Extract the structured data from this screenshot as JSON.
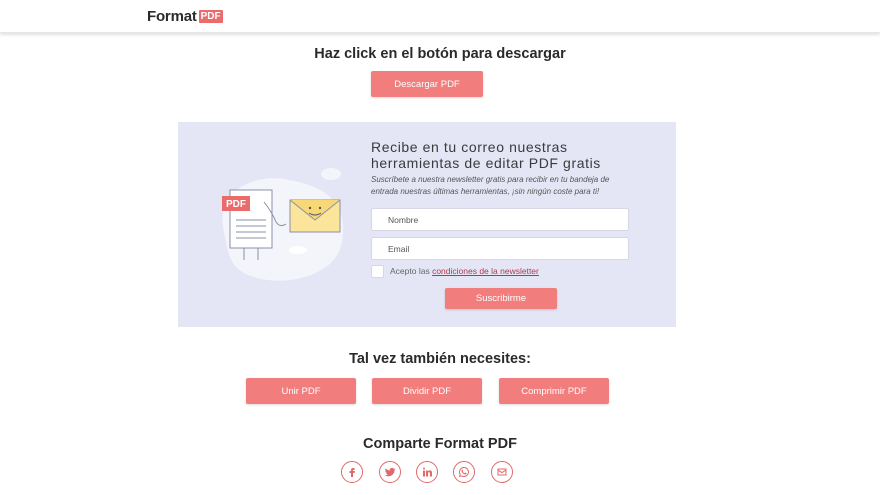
{
  "header": {
    "logo_text": "Format",
    "logo_badge": "PDF"
  },
  "download": {
    "title": "Haz click en el botón para descargar",
    "button_label": "Descargar PDF"
  },
  "newsletter": {
    "title": "Recibe en tu correo nuestras herramientas de editar PDF gratis",
    "subtitle": "Suscríbete a nuestra newsletter gratis para recibir en tu bandeja de entrada nuestras últimas herramientas, ¡sin ningún coste para ti!",
    "illustration_badge": "PDF",
    "name_placeholder": "Nombre",
    "email_placeholder": "Email",
    "accept_prefix": "Acepto las",
    "accept_link": "condiciones de la newsletter",
    "subscribe_label": "Suscribirme"
  },
  "tools": {
    "title": "Tal vez también necesites:",
    "items": [
      "Unir PDF",
      "Dividir PDF",
      "Comprimir PDF"
    ]
  },
  "share": {
    "title": "Comparte Format PDF",
    "icons": [
      "facebook-icon",
      "twitter-icon",
      "linkedin-icon",
      "whatsapp-icon",
      "email-icon"
    ]
  },
  "colors": {
    "accent": "#f27d7d",
    "panel_bg": "#e4e6f6"
  }
}
